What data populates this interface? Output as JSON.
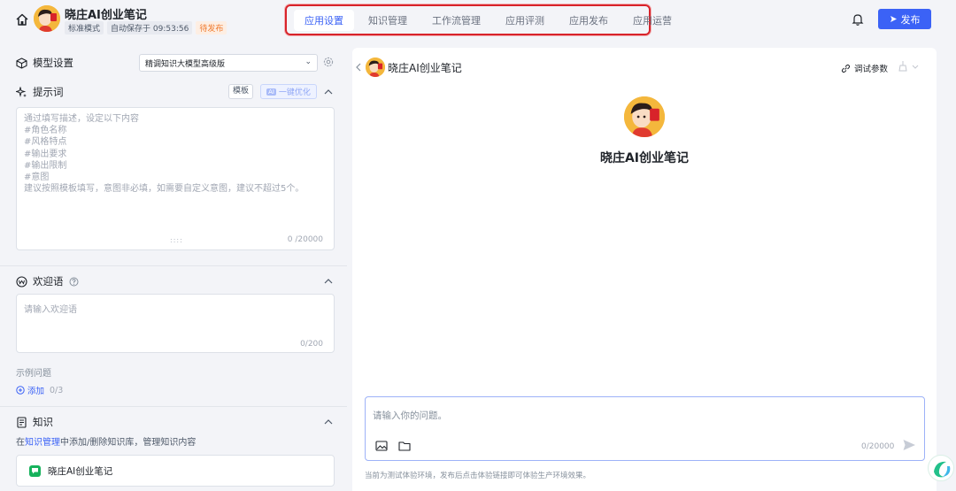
{
  "header": {
    "app_title": "晓庄AI创业笔记",
    "mode": "标准模式",
    "autosave": "自动保存于 09:53:56",
    "status": "待发布",
    "tabs": [
      {
        "label": "应用设置",
        "active": true
      },
      {
        "label": "知识管理",
        "active": false
      },
      {
        "label": "工作流管理",
        "active": false
      },
      {
        "label": "应用评测",
        "active": false
      },
      {
        "label": "应用发布",
        "active": false
      },
      {
        "label": "应用运营",
        "active": false
      }
    ],
    "publish_label": "发布"
  },
  "model": {
    "section_label": "模型设置",
    "selected": "精调知识大模型高级版"
  },
  "prompt": {
    "section_label": "提示词",
    "template_label": "模板",
    "optimize_label": "一键优化",
    "optimize_badge": "AI",
    "placeholder_lines": [
      "通过填写描述，设定以下内容",
      "#角色名称",
      "#风格特点",
      "#输出要求",
      "#输出限制",
      "#意图",
      "建议按照模板填写，意图非必填，如需要自定义意图，建议不超过5个。"
    ],
    "counter": "0 /20000"
  },
  "welcome": {
    "section_label": "欢迎语",
    "placeholder": "请输入欢迎语",
    "counter": "0/200",
    "examples_label": "示例问题",
    "add_label": "添加",
    "add_count": "0/3"
  },
  "knowledge": {
    "section_label": "知识",
    "hint_prefix": "在",
    "hint_link": "知识管理",
    "hint_suffix": "中添加/删除知识库，管理知识内容",
    "items": [
      {
        "name": "晓庄AI创业笔记"
      }
    ]
  },
  "preview": {
    "name": "晓庄AI创业笔记",
    "debug_label": "调试参数",
    "big_name": "晓庄AI创业笔记",
    "input_placeholder": "请输入你的问题。",
    "input_counter": "0/20000",
    "env_note": "当前为测试体验环境，发布后点击体验链接即可体验生产环境效果。"
  },
  "colors": {
    "accent": "#3b62f6",
    "highlight_box": "#d8232a",
    "warning": "#f07a2e",
    "kb_green": "#16b25c"
  }
}
